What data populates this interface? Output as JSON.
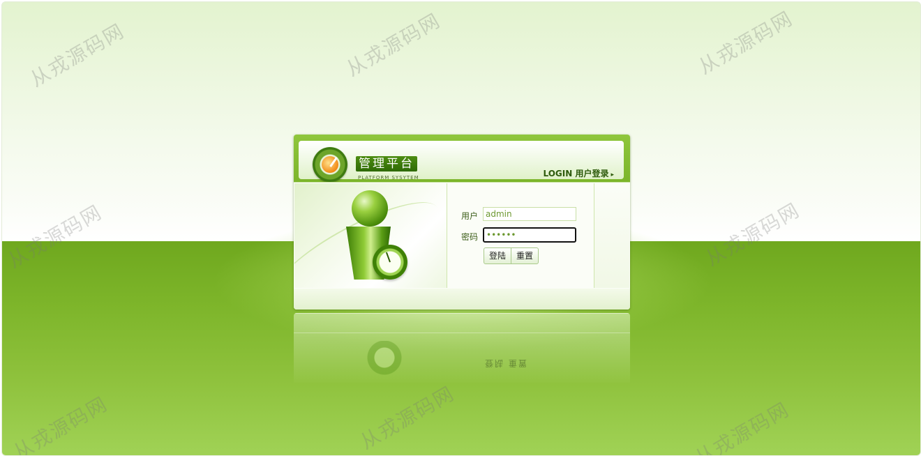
{
  "header": {
    "brand_title": "管理平台",
    "brand_subtitle": "PLATFORM SYSYTEM",
    "login_title": "LOGIN 用户登录",
    "login_arrow": "▸"
  },
  "form": {
    "username_label": "用户",
    "username_value": "admin",
    "password_label": "密码",
    "password_value": "••••••",
    "login_button": "登陆",
    "reset_button": "重置"
  },
  "reflection": {
    "buttons_text": "登陆 重置"
  },
  "watermark": {
    "text": "从戎源码网"
  },
  "colors": {
    "accent": "#7cb52b",
    "ground": "#76af24",
    "brand_bg": "#3d7c0c"
  },
  "icons": [
    "logo-gauge-icon",
    "user-figure-icon",
    "clock-icon",
    "arrow-right-icon"
  ]
}
